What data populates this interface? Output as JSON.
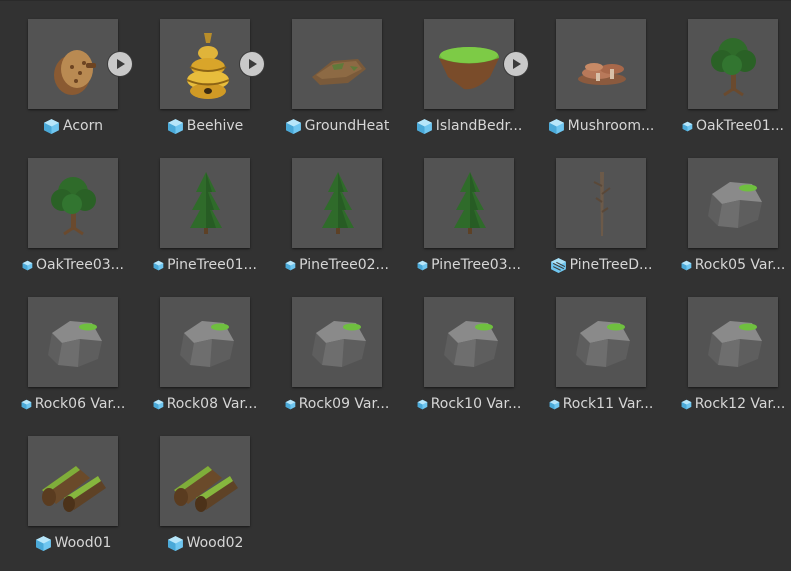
{
  "assets": [
    {
      "name": "Acorn",
      "icon": "prefab-variant-cube-icon",
      "thumbnail": "acorn",
      "expand_arrow": true
    },
    {
      "name": "Beehive",
      "icon": "prefab-variant-cube-icon",
      "thumbnail": "beehive",
      "expand_arrow": true
    },
    {
      "name": "GroundHeat",
      "icon": "prefab-cube-icon",
      "thumbnail": "ground-heat",
      "expand_arrow": false
    },
    {
      "name": "IslandBedr...",
      "icon": "prefab-cube-icon",
      "thumbnail": "island-bedrock",
      "expand_arrow": true
    },
    {
      "name": "Mushroom...",
      "icon": "prefab-cube-icon",
      "thumbnail": "mushroom",
      "expand_arrow": false
    },
    {
      "name": "OakTree01...",
      "icon": "prefab-variant-cube-icon",
      "thumbnail": "oak-tree",
      "expand_arrow": false
    },
    {
      "name": "OakTree03...",
      "icon": "prefab-variant-cube-icon",
      "thumbnail": "oak-tree",
      "expand_arrow": false
    },
    {
      "name": "PineTree01...",
      "icon": "prefab-variant-cube-icon",
      "thumbnail": "pine-tree",
      "expand_arrow": false
    },
    {
      "name": "PineTree02...",
      "icon": "prefab-variant-cube-icon",
      "thumbnail": "pine-tree",
      "expand_arrow": false
    },
    {
      "name": "PineTree03...",
      "icon": "prefab-variant-cube-icon",
      "thumbnail": "pine-tree",
      "expand_arrow": false
    },
    {
      "name": "PineTreeD...",
      "icon": "prefab-model-cube-icon",
      "thumbnail": "dead-pine-tree",
      "expand_arrow": false
    },
    {
      "name": "Rock05 Var...",
      "icon": "prefab-variant-cube-icon",
      "thumbnail": "rock",
      "expand_arrow": false
    },
    {
      "name": "Rock06 Var...",
      "icon": "prefab-variant-cube-icon",
      "thumbnail": "rock",
      "expand_arrow": false
    },
    {
      "name": "Rock08 Var...",
      "icon": "prefab-variant-cube-icon",
      "thumbnail": "rock",
      "expand_arrow": false
    },
    {
      "name": "Rock09 Var...",
      "icon": "prefab-variant-cube-icon",
      "thumbnail": "rock",
      "expand_arrow": false
    },
    {
      "name": "Rock10 Var...",
      "icon": "prefab-variant-cube-icon",
      "thumbnail": "rock",
      "expand_arrow": false
    },
    {
      "name": "Rock11 Var...",
      "icon": "prefab-variant-cube-icon",
      "thumbnail": "rock",
      "expand_arrow": false
    },
    {
      "name": "Rock12 Var...",
      "icon": "prefab-variant-cube-icon",
      "thumbnail": "rock",
      "expand_arrow": false
    },
    {
      "name": "Wood01",
      "icon": "prefab-cube-icon",
      "thumbnail": "wood-log",
      "expand_arrow": false
    },
    {
      "name": "Wood02",
      "icon": "prefab-cube-icon",
      "thumbnail": "wood-log",
      "expand_arrow": false
    }
  ],
  "colors": {
    "background": "#323232",
    "thumbnail_bg": "#535353",
    "label_text": "#d6d6d6",
    "prefab_icon": "#6fc6f0"
  }
}
